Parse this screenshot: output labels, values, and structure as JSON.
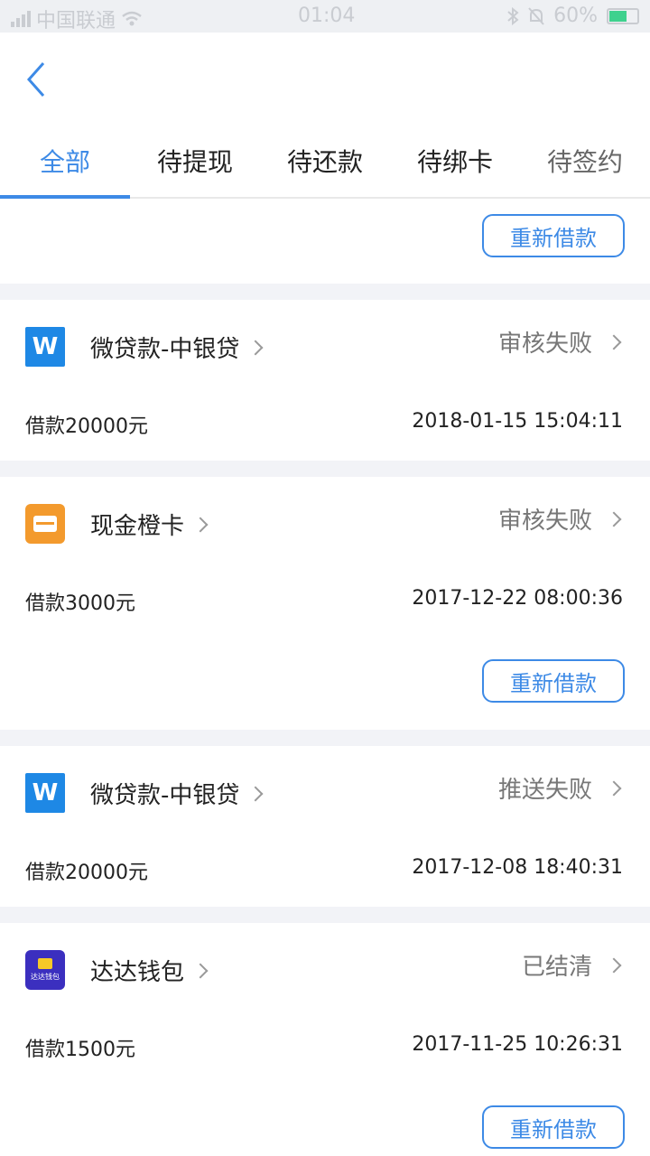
{
  "status_bar": {
    "carrier": "中国联通",
    "time": "01:04",
    "battery": "60%"
  },
  "tabs": [
    {
      "label": "全部",
      "active": true
    },
    {
      "label": "待提现",
      "active": false
    },
    {
      "label": "待还款",
      "active": false
    },
    {
      "label": "待绑卡",
      "active": false
    },
    {
      "label": "待签约",
      "active": false
    }
  ],
  "redo_label": "重新借款",
  "loans": [
    {
      "name": "微贷款-中银贷",
      "status": "审核失败",
      "amount": "借款20000元",
      "date": "2018-01-15 15:04:11",
      "logo": "w-logo"
    },
    {
      "name": "现金橙卡",
      "status": "审核失败",
      "amount": "借款3000元",
      "date": "2017-12-22 08:00:36",
      "logo": "orange-card-logo"
    },
    {
      "name": "微贷款-中银贷",
      "status": "推送失败",
      "amount": "借款20000元",
      "date": "2017-12-08 18:40:31",
      "logo": "w-logo"
    },
    {
      "name": "达达钱包",
      "status": "已结清",
      "amount": "借款1500元",
      "date": "2017-11-25 10:26:31",
      "logo": "wallet-logo",
      "logo_text": "达达钱包"
    }
  ],
  "colors": {
    "accent": "#3d8ae6"
  }
}
